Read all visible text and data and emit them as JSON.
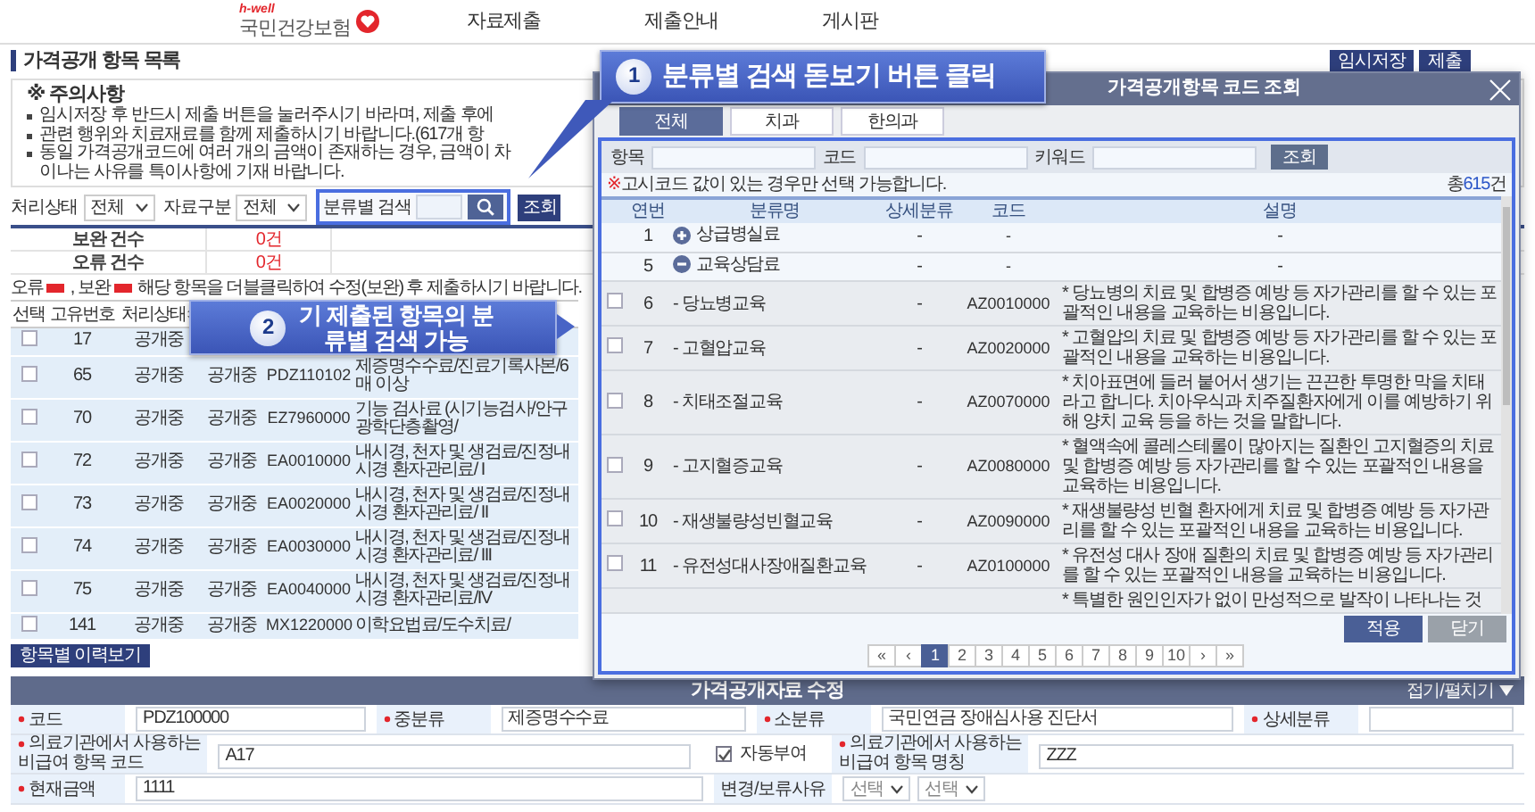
{
  "header": {
    "logo_tag": "h-well",
    "logo_text": "국민건강보험",
    "nav": [
      "자료제출",
      "제출안내",
      "게시판"
    ]
  },
  "page_title": "가격공개 항목 목록",
  "actions": [
    "임시저장",
    "제출"
  ],
  "notice": {
    "title": "※ 주의사항",
    "items": [
      "임시저장 후 반드시 제출 버튼을 눌러주시기 바라며, 제출 후에",
      "관련 행위와 치료재료를 함께 제출하시기 바랍니다.(617개 항",
      "동일 가격공개코드에 여러 개의 금액이 존재하는 경우, 금액이 차이나는 사유를 특이사항에 기재 바랍니다."
    ]
  },
  "filters": {
    "status_label": "처리상태",
    "status_value": "전체",
    "type_label": "자료구분",
    "type_value": "전체",
    "search_label": "분류별 검색",
    "query_button": "조회"
  },
  "counts": [
    {
      "label": "보완 건수",
      "value": "0건"
    },
    {
      "label": "오류 건수",
      "value": "0건"
    }
  ],
  "legend": {
    "items": [
      {
        "label": "오류",
        "color": "#e3262c"
      },
      {
        "label": ", 보완",
        "color": "#e3262c"
      }
    ],
    "text": "해당 항목을 더블클릭하여 수정(보완) 후 제출하시기 바랍니다."
  },
  "table": {
    "columns": [
      {
        "label": "선택",
        "sortable": false
      },
      {
        "label": "고유번호",
        "sortable": false
      },
      {
        "label": "처리상태",
        "sortable": true
      }
    ],
    "rows": [
      {
        "checked": false,
        "id": "17",
        "status": "공개중"
      },
      {
        "checked": false,
        "id": "65",
        "status": "공개중",
        "column_4": "공개중",
        "code": "PDZ110102",
        "name": "제증명수수료/진료기록사본/6매 이상"
      },
      {
        "checked": false,
        "id": "70",
        "status": "공개중",
        "column_4": "공개중",
        "code": "EZ7960000",
        "name": "기능 검사료 (시기능검사/안구광학단층촬영/"
      },
      {
        "checked": false,
        "id": "72",
        "status": "공개중",
        "column_4": "공개중",
        "code": "EA0010000",
        "name": "내시경, 천자 및 생검료/진정내시경 환자관리료/ I"
      },
      {
        "checked": false,
        "id": "73",
        "status": "공개중",
        "column_4": "공개중",
        "code": "EA0020000",
        "name": "내시경, 천자 및 생검료/진정내시경 환자관리료/ II"
      },
      {
        "checked": false,
        "id": "74",
        "status": "공개중",
        "column_4": "공개중",
        "code": "EA0030000",
        "name": "내시경, 천자 및 생검료/진정내시경 환자관리료/ III"
      },
      {
        "checked": false,
        "id": "75",
        "status": "공개중",
        "column_4": "공개중",
        "code": "EA0040000",
        "name": "내시경, 천자 및 생검료/진정내시경 환자관리료/IV"
      },
      {
        "checked": false,
        "id": "141",
        "status": "공개중",
        "column_4": "공개중",
        "code": "MX1220000",
        "name": "이학요법료/도수치료/"
      }
    ]
  },
  "history_button": "항목별 이력보기",
  "callouts": [
    {
      "number": "1",
      "text": "분류별 검색 돋보기 버튼 클릭"
    },
    {
      "number": "2",
      "text": "기 제출된 항목의 분류별 검색 가능"
    }
  ],
  "modal": {
    "title": "가격공개항목 코드 조회",
    "tabs": [
      {
        "label": "전체",
        "selected": true
      },
      {
        "label": "치과",
        "selected": false
      },
      {
        "label": "한의과",
        "selected": false
      }
    ],
    "search_fields": [
      "항목",
      "코드",
      "키워드"
    ],
    "search_button": "조회",
    "note_mark": "※",
    "note": "고시코드 값이 있는 경우만 선택 가능합니다.",
    "total_prefix": "총",
    "total_count": "615",
    "total_suffix": "건",
    "columns": [
      "연번",
      "분류명",
      "상세분류",
      "코드",
      "설명"
    ],
    "rows": [
      {
        "no": "1",
        "name": "상급병실료",
        "detail": "-",
        "code": "-",
        "desc": "-",
        "expanded": false
      },
      {
        "no": "5",
        "name": "교육상담료",
        "detail": "-",
        "code": "-",
        "desc": "-",
        "expanded": true,
        "children": [
          {
            "checked": false,
            "no": "6",
            "name": "- 당뇨병교육",
            "detail": "-",
            "code": "AZ0010000",
            "desc": "* 당뇨병의 치료 및 합병증 예방 등 자가관리를 할 수 있는 포괄적인 내용을 교육하는 비용입니다."
          },
          {
            "checked": false,
            "no": "7",
            "name": "- 고혈압교육",
            "detail": "-",
            "code": "AZ0020000",
            "desc": "* 고혈압의 치료 및 합병증 예방 등 자가관리를 할 수 있는 포괄적인 내용을 교육하는 비용입니다."
          },
          {
            "checked": false,
            "no": "8",
            "name": "- 치태조절교육",
            "detail": "-",
            "code": "AZ0070000",
            "desc": "* 치아표면에 들러 붙어서 생기는 끈끈한 투명한 막을 치태라고 합니다. 치아우식과 치주질환자에게 이를 예방하기 위해 양치 교육 등을 하는 것을 말합니다."
          },
          {
            "checked": false,
            "no": "9",
            "name": "- 고지혈증교육",
            "detail": "-",
            "code": "AZ0080000",
            "desc": "* 혈액속에 콜레스테롤이 많아지는 질환인 고지혈증의 치료 및 합병증 예방 등 자가관리를 할 수 있는 포괄적인 내용을 교육하는 비용입니다."
          },
          {
            "checked": false,
            "no": "10",
            "name": "- 재생불량성빈혈교육",
            "detail": "-",
            "code": "AZ0090000",
            "desc": "* 재생불량성 빈혈 환자에게 치료 및 합병증 예방 등 자가관리를 할 수 있는 포괄적인 내용을 교육하는 비용입니다."
          },
          {
            "checked": false,
            "no": "11",
            "name": "- 유전성대사장애질환교육",
            "detail": "-",
            "code": "AZ0100000",
            "desc": "* 유전성 대사 장애 질환의 치료 및 합병증 예방 등 자가관리를 할 수 있는 포괄적인 내용을 교육하는 비용입니다."
          },
          {
            "desc": "* 특별한 원인인자가 없이 만성적으로 발작이 나타나는 것"
          }
        ]
      }
    ],
    "buttons": [
      {
        "label": "적용",
        "kind": "primary"
      },
      {
        "label": "닫기",
        "kind": "secondary"
      }
    ],
    "pages": [
      {
        "label": "«",
        "selected": false
      },
      {
        "label": "‹",
        "selected": false
      },
      {
        "label": "1",
        "selected": true
      },
      {
        "label": "2",
        "selected": false
      },
      {
        "label": "3",
        "selected": false
      },
      {
        "label": "4",
        "selected": false
      },
      {
        "label": "5",
        "selected": false
      },
      {
        "label": "6",
        "selected": false
      },
      {
        "label": "7",
        "selected": false
      },
      {
        "label": "8",
        "selected": false
      },
      {
        "label": "9",
        "selected": false
      },
      {
        "label": "10",
        "selected": false
      },
      {
        "label": "›",
        "selected": false
      },
      {
        "label": "»",
        "selected": false
      }
    ]
  },
  "edit_form": {
    "title": "가격공개자료 수정",
    "toggle": "접기/펼치기",
    "rows": [
      [
        {
          "kind": "field",
          "label": "코드",
          "required": true,
          "value": "PDZ100000"
        },
        {
          "kind": "field",
          "label": "중분류",
          "required": true,
          "value": "제증명수수료"
        },
        {
          "kind": "field",
          "label": "소분류",
          "required": true,
          "value": "국민연금 장애심사용 진단서"
        },
        {
          "kind": "field",
          "label": "상세분류",
          "required": true
        }
      ],
      [
        {
          "kind": "field",
          "label_note": "의료기관에서 사용하는",
          "label": "비급여 항목 코드",
          "required": true,
          "value": "A17"
        },
        {
          "kind": "checkbox",
          "label": "자동부여",
          "checked": true
        },
        {
          "kind": "field",
          "label_note": "의료기관에서 사용하는",
          "label": "비급여 항목 명칭",
          "required": true,
          "value": "ZZZ"
        }
      ],
      [
        {
          "kind": "field",
          "label": "현재금액",
          "required": true,
          "value": "1111"
        },
        {
          "kind": "selects",
          "label": "변경/보류사유",
          "required": false,
          "values": [
            "선택",
            "선택"
          ]
        }
      ]
    ]
  }
}
